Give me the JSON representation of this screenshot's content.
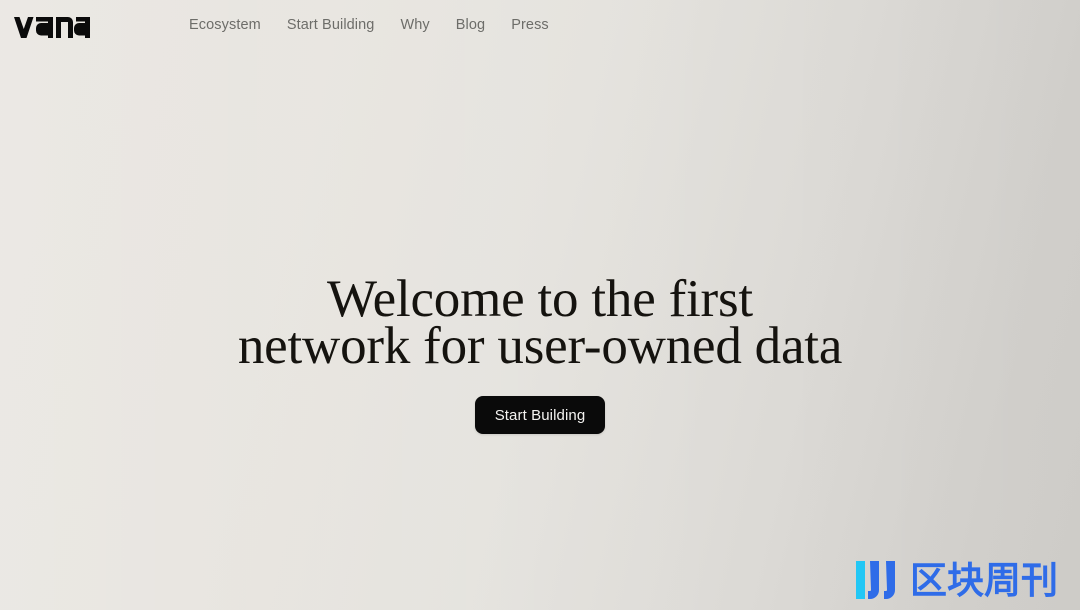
{
  "site": {
    "brand_name": "vana",
    "background_color_left": "#e9e6e1",
    "background_color_right": "#d1cfcb"
  },
  "nav": {
    "items": [
      {
        "label": "Ecosystem"
      },
      {
        "label": "Start Building"
      },
      {
        "label": "Why"
      },
      {
        "label": "Blog"
      },
      {
        "label": "Press"
      }
    ],
    "link_color": "#6d6d69"
  },
  "hero": {
    "headline_line1": "Welcome to the first",
    "headline_line2": "network for user-owned data",
    "headline_color": "#15130f",
    "cta_label": "Start Building",
    "cta_background": "#0a0a0a",
    "cta_text_color": "#f4f3f1"
  },
  "watermark": {
    "text": "区块周刊",
    "icon_name": "blue-bars-logo",
    "color_blue": "#2f6ce8",
    "color_cyan": "#22c7f5"
  }
}
